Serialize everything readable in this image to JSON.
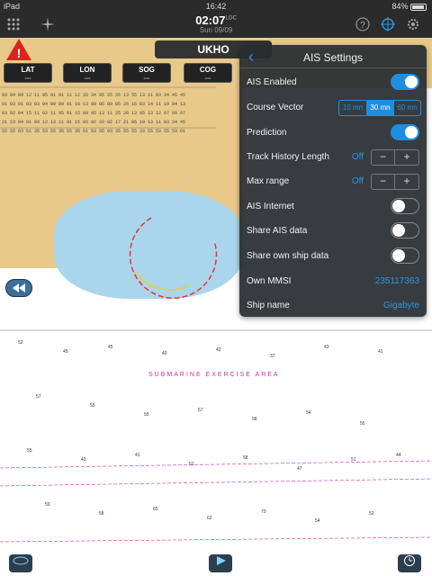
{
  "status": {
    "device": "iPad",
    "time": "16:42",
    "battery": "84%"
  },
  "toolbar": {
    "time": "02:07",
    "time_sup": "LOC",
    "date": "Sun 09/09"
  },
  "chart": {
    "source_label": "UKHO",
    "exercise_area": "SUBMARINE EXERCISE AREA"
  },
  "databoxes": [
    {
      "label": "LAT",
      "value": "---"
    },
    {
      "label": "LON",
      "value": "---"
    },
    {
      "label": "SOG",
      "value": "---"
    },
    {
      "label": "COG",
      "value": "---"
    }
  ],
  "settings": {
    "title": "AIS Settings",
    "ais_enabled": {
      "label": "AIS Enabled",
      "state": "on"
    },
    "course_vector": {
      "label": "Course Vector",
      "options": [
        "10 mn",
        "30 mn",
        "60 mn"
      ],
      "selected": "30 mn"
    },
    "prediction": {
      "label": "Prediction",
      "state": "on"
    },
    "track_history": {
      "label": "Track History Length",
      "value": "Off"
    },
    "max_range": {
      "label": "Max range",
      "value": "Off"
    },
    "ais_internet": {
      "label": "AIS Internet",
      "state": "off"
    },
    "share_ais": {
      "label": "Share AIS data",
      "state": "off"
    },
    "share_own": {
      "label": "Share own ship data",
      "state": "off"
    },
    "own_mmsi": {
      "label": "Own MMSI",
      "value": "235117363"
    },
    "ship_name": {
      "label": "Ship name",
      "value": "Gigabyte"
    }
  },
  "icons": {
    "grid": "grid-icon",
    "compass": "compass-icon",
    "help": "help-icon",
    "target": "target-icon",
    "gear": "gear-icon"
  }
}
